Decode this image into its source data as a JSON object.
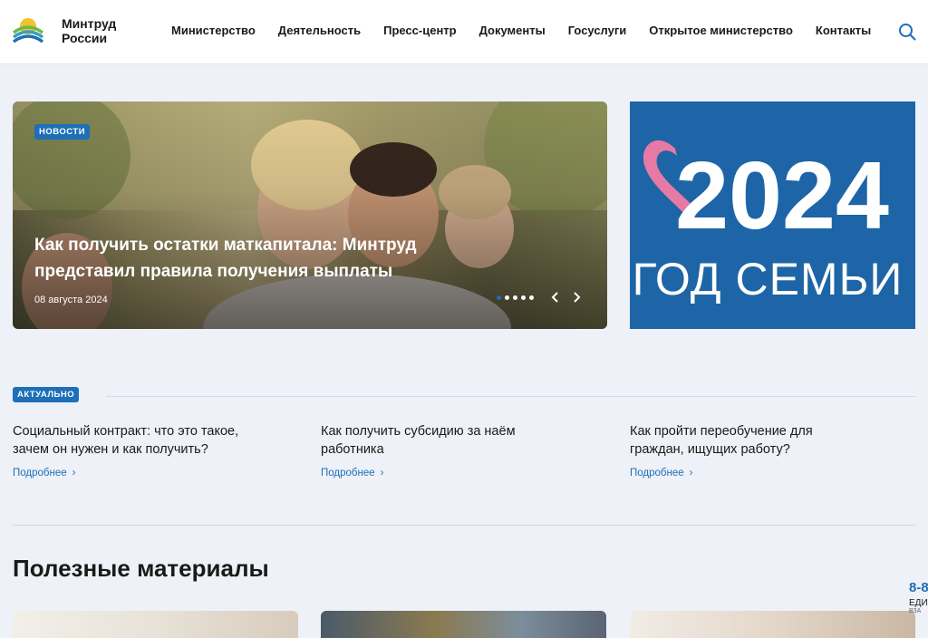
{
  "header": {
    "logo_text": "Минтруд России",
    "nav": [
      "Министерство",
      "Деятельность",
      "Пресс-центр",
      "Документы",
      "Госуслуги",
      "Открытое министерство",
      "Контакты"
    ]
  },
  "hero": {
    "badge": "НОВОСТИ",
    "title": "Как получить остатки маткапитала: Минтруд представил правила получения выплаты",
    "date": "08 августа 2024",
    "slides_total": 5,
    "slide_active": 1
  },
  "family_banner": {
    "year": "2024",
    "caption": "ГОД СЕМЬИ"
  },
  "aktualno": {
    "badge": "АКТУАЛЬНО",
    "items": [
      {
        "title": "Социальный контракт: что это такое, зачем он нужен и как получить?",
        "more": "Подробнее"
      },
      {
        "title": "Как получить субсидию за наём работника",
        "more": "Подробнее"
      },
      {
        "title": "Как пройти переобучение для граждан, ищущих работу?",
        "more": "Подробнее"
      }
    ]
  },
  "useful": {
    "title": "Полезные материалы"
  },
  "hotline": {
    "number": "8-8",
    "line1": "ЕДИ",
    "line2": "ВЗА"
  },
  "colors": {
    "accent": "#1d6fb8",
    "banner_blue": "#1d65a6",
    "heart_pink": "#e77aa5",
    "background": "#eef1f7"
  }
}
